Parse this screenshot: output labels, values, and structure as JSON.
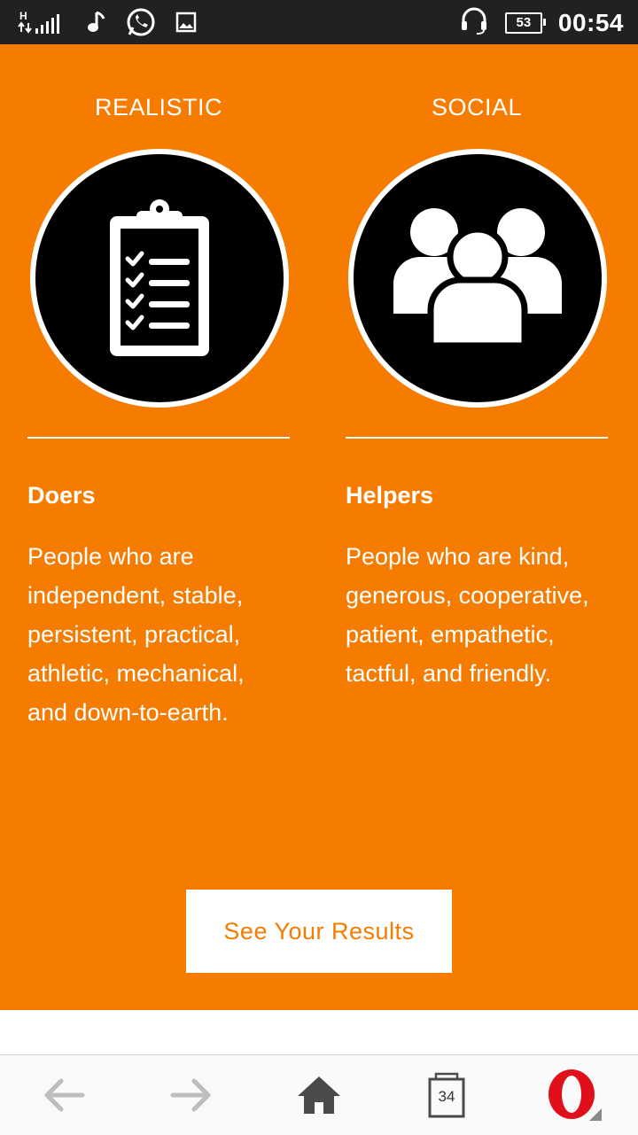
{
  "status_bar": {
    "network": "H",
    "battery": "53",
    "time": "00:54"
  },
  "columns": [
    {
      "title": "REALISTIC",
      "icon": "clipboard-checklist-icon",
      "heading": "Doers",
      "description": "People who are independent, stable, persistent, practical, athletic, mechanical, and down-to-earth."
    },
    {
      "title": "SOCIAL",
      "icon": "people-group-icon",
      "heading": "Helpers",
      "description": "People who are kind, generous, cooperative, patient, empathetic, tactful, and friendly."
    }
  ],
  "cta": {
    "label": "See Your Results"
  },
  "browser_nav": {
    "tabs_count": "34"
  },
  "colors": {
    "accent": "#f57c00",
    "status_bar": "#212121",
    "circle": "#000000",
    "text_on_accent": "#ffffff"
  }
}
